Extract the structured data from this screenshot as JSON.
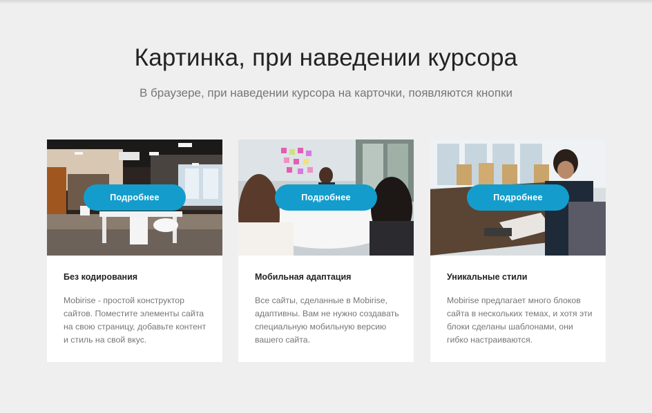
{
  "header": {
    "title": "Картинка, при наведении курсора",
    "subtitle": "В браузере, при наведении курсора на карточки, появляются кнопки"
  },
  "cards": [
    {
      "image": "office-interior-photo",
      "button_label": "Подробнее",
      "title": "Без кодирования",
      "text": "Mobirise - простой конструктор сайтов. Поместите элементы сайта на свою страницу, добавьте контент и стиль на свой вкус."
    },
    {
      "image": "team-meeting-photo",
      "button_label": "Подробнее",
      "title": "Мобильная адаптация",
      "text": "Все сайты, сделанные в Mobirise, адаптивны. Вам не нужно создавать специальную мобильную версию вашего сайта."
    },
    {
      "image": "man-at-laptop-photo",
      "button_label": "Подробнее",
      "title": "Уникальные стили",
      "text": "Mobirise предлагает много блоков сайта в нескольких темах, и хотя эти блоки сделаны шаблонами, они гибко настраиваются."
    }
  ],
  "colors": {
    "background": "#efefef",
    "card": "#ffffff",
    "accent": "#149dcc",
    "heading": "#232323",
    "muted": "#767676"
  }
}
